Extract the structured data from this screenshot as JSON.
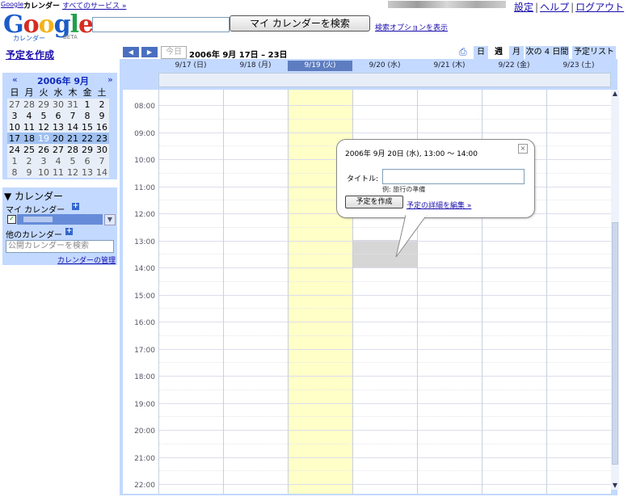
{
  "topbar": {
    "google": "Google",
    "calendar": "カレンダー",
    "all_services": "すべてのサービス »",
    "links": [
      "設定",
      "ヘルプ",
      "ログアウト"
    ]
  },
  "logo": {
    "text": "Google",
    "sub": "カレンダー",
    "beta": "BETA"
  },
  "search": {
    "button": "マイ カレンダーを検索",
    "options": "検索オプションを表示"
  },
  "create_event": "予定を作成",
  "minical": {
    "prev": "«",
    "next": "»",
    "title": "2006年 9月",
    "weekdays": [
      "日",
      "月",
      "火",
      "水",
      "木",
      "金",
      "土"
    ],
    "weeks": [
      [
        "27",
        "28",
        "29",
        "30",
        "31",
        "1",
        "2"
      ],
      [
        "3",
        "4",
        "5",
        "6",
        "7",
        "8",
        "9"
      ],
      [
        "10",
        "11",
        "12",
        "13",
        "14",
        "15",
        "16"
      ],
      [
        "17",
        "18",
        "19",
        "20",
        "21",
        "22",
        "23"
      ],
      [
        "24",
        "25",
        "26",
        "27",
        "28",
        "29",
        "30"
      ],
      [
        "1",
        "2",
        "3",
        "4",
        "5",
        "6",
        "7"
      ],
      [
        "8",
        "9",
        "10",
        "11",
        "12",
        "13",
        "14"
      ]
    ]
  },
  "calendars": {
    "header": "▼ カレンダー",
    "my": "マイ カレンダー",
    "other": "他のカレンダー",
    "public_placeholder": "公開カレンダーを検索",
    "manage": "カレンダーの管理",
    "accent": "#668cd9"
  },
  "nav": {
    "prev": "◀",
    "next": "▶",
    "today": "今日",
    "range": "2006年 9月 17日 – 23日",
    "print_icon": "printer-icon",
    "tabs": [
      "日",
      "週",
      "月",
      "次の 4 日間",
      "予定リスト"
    ],
    "selected_tab": "週"
  },
  "days": [
    "9/17 (日)",
    "9/18 (月)",
    "9/19 (火)",
    "9/20 (水)",
    "9/21 (木)",
    "9/22 (金)",
    "9/23 (土)"
  ],
  "times": [
    "08:00",
    "09:00",
    "10:00",
    "11:00",
    "12:00",
    "13:00",
    "14:00",
    "15:00",
    "16:00",
    "17:00",
    "18:00",
    "19:00",
    "20:00",
    "21:00",
    "22:00"
  ],
  "popup": {
    "when": "2006年 9月 20日 (水), 13:00 ～ 14:00",
    "title_label": "タイトル:",
    "example": "例: 旅行の準備",
    "create_button": "予定を作成",
    "edit_link": "予定の詳細を編集 »",
    "close": "×"
  },
  "colors": {
    "today_column": "#ffffc8",
    "panel": "#c3d9ff",
    "selected_day": "#5e7dc0"
  }
}
